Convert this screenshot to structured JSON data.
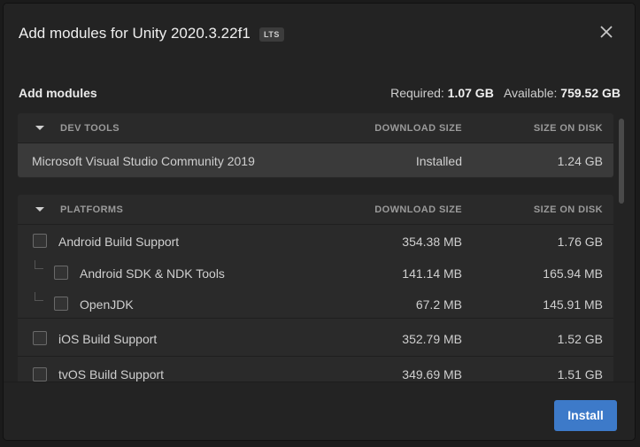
{
  "dialog": {
    "title": "Add modules for Unity 2020.3.22f1",
    "badge": "LTS",
    "close_icon": "close-icon"
  },
  "summary": {
    "section_title": "Add modules",
    "required_label": "Required:",
    "required_value": "1.07 GB",
    "available_label": "Available:",
    "available_value": "759.52 GB"
  },
  "dev_tools": {
    "header": "DEV TOOLS",
    "col_download": "DOWNLOAD SIZE",
    "col_disk": "SIZE ON DISK",
    "rows": [
      {
        "name": "Microsoft Visual Studio Community 2019",
        "download": "Installed",
        "disk": "1.24 GB"
      }
    ]
  },
  "platforms": {
    "header": "PLATFORMS",
    "col_download": "DOWNLOAD SIZE",
    "col_disk": "SIZE ON DISK",
    "rows": [
      {
        "name": "Android Build Support",
        "download": "354.38 MB",
        "disk": "1.76 GB",
        "checked": false
      },
      {
        "name": "Android SDK & NDK Tools",
        "download": "141.14 MB",
        "disk": "165.94 MB",
        "checked": false
      },
      {
        "name": "OpenJDK",
        "download": "67.2 MB",
        "disk": "145.91 MB",
        "checked": false
      },
      {
        "name": "iOS Build Support",
        "download": "352.79 MB",
        "disk": "1.52 GB",
        "checked": false
      },
      {
        "name": "tvOS Build Support",
        "download": "349.69 MB",
        "disk": "1.51 GB",
        "checked": false
      }
    ]
  },
  "footer": {
    "install_label": "Install"
  },
  "colors": {
    "accent": "#3d7ac9",
    "background": "#232323",
    "panel": "#2a2a2a"
  }
}
